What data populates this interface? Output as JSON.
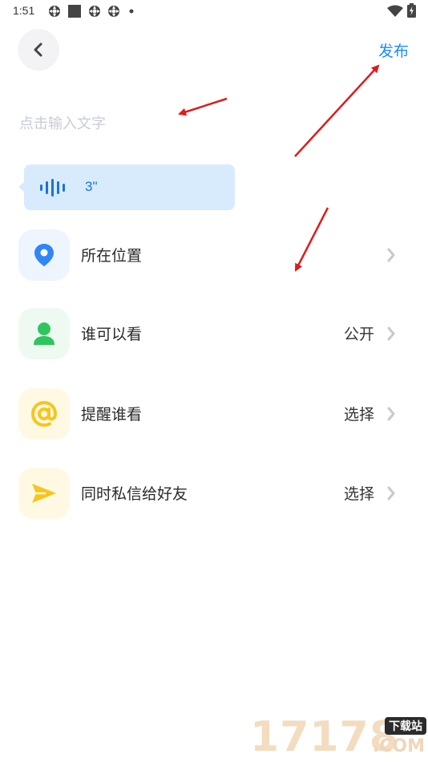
{
  "status_bar": {
    "time": "1:51",
    "icons": [
      "app-notification-icon",
      "stop-square-icon",
      "app-notification-icon",
      "app-notification-icon",
      "dot-icon"
    ],
    "right_icons": [
      "wifi-icon",
      "battery-charging-icon"
    ]
  },
  "header": {
    "back_icon": "chevron-left-icon",
    "publish_label": "发布"
  },
  "compose": {
    "placeholder": "点击输入文字",
    "value": ""
  },
  "voice_message": {
    "icon": "voice-wave-icon",
    "duration": "3\""
  },
  "options": [
    {
      "label": "所在位置",
      "value": "",
      "icon": "location-pin-icon",
      "icon_color": "#2f86f6",
      "bg": "#eef5fe"
    },
    {
      "label": "谁可以看",
      "value": "公开",
      "icon": "person-icon",
      "icon_color": "#2fc55e",
      "bg": "#eefaf1"
    },
    {
      "label": "提醒谁看",
      "value": "选择",
      "icon": "at-sign-icon",
      "icon_color": "#f7c51c",
      "bg": "#fff9e4"
    },
    {
      "label": "同时私信给好友",
      "value": "选择",
      "icon": "send-arrow-icon",
      "icon_color": "#f7c51c",
      "bg": "#fff9e4"
    }
  ],
  "watermark": {
    "digits": "17178",
    "cn": "下载站",
    "com": ".COM"
  },
  "colors": {
    "accent": "#1a8cff",
    "annotation_arrow": "#e01b1b"
  }
}
